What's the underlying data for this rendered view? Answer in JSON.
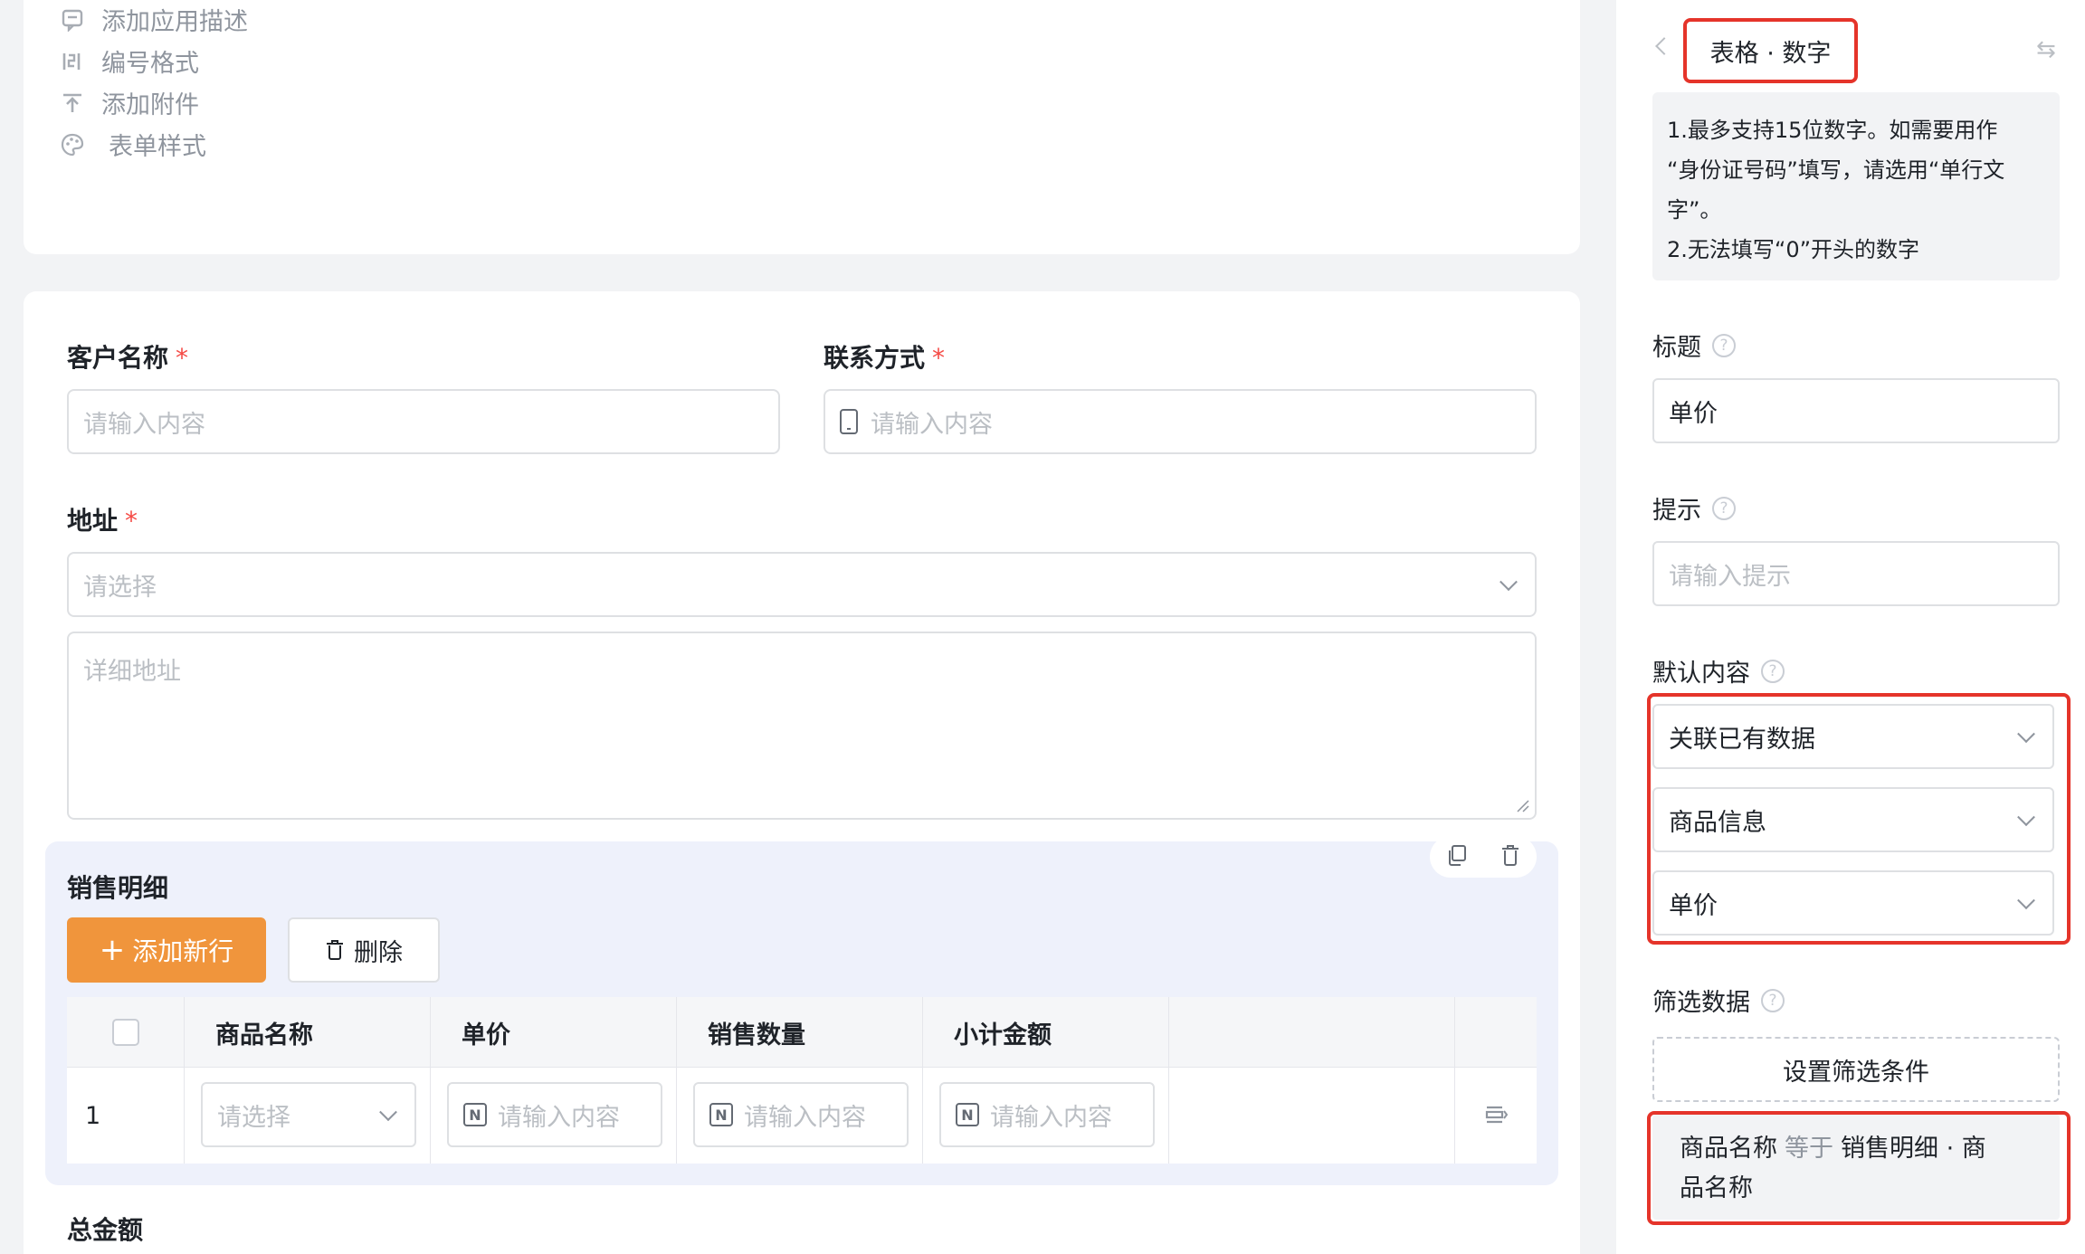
{
  "top_menu": {
    "items": [
      {
        "label": "添加应用描述",
        "icon": "comment-icon"
      },
      {
        "label": "编号格式",
        "icon": "number-format-icon"
      },
      {
        "label": "添加附件",
        "icon": "upload-icon"
      },
      {
        "label": "表单样式",
        "icon": "palette-icon"
      }
    ]
  },
  "form": {
    "customer": {
      "label": "客户名称",
      "required": "*",
      "placeholder": "请输入内容"
    },
    "contact": {
      "label": "联系方式",
      "required": "*",
      "placeholder": "请输入内容"
    },
    "address": {
      "label": "地址",
      "required": "*",
      "select_placeholder": "请选择",
      "detail_placeholder": "详细地址"
    },
    "sales_detail": {
      "title": "销售明细",
      "add_button": "添加新行",
      "delete_button": "删除",
      "columns": [
        "商品名称",
        "单价",
        "销售数量",
        "小计金额"
      ],
      "row": {
        "index": "1",
        "product_placeholder": "请选择",
        "price_placeholder": "请输入内容",
        "qty_placeholder": "请输入内容",
        "subtotal_placeholder": "请输入内容"
      }
    },
    "total_label": "总金额"
  },
  "panel": {
    "field_type": "表格 · 数字",
    "tip_lines": [
      "1.最多支持15位数字。如需要用作",
      "“身份证号码”填写，请选用“单行文",
      "字”。",
      "2.无法填写“0”开头的数字"
    ],
    "title_label": "标题",
    "title_value": "单价",
    "hint_label": "提示",
    "hint_placeholder": "请输入提示",
    "default_label": "默认内容",
    "default_mode": "关联已有数据",
    "default_source": "商品信息",
    "default_field": "单价",
    "filter_label": "筛选数据",
    "filter_button": "设置筛选条件",
    "condition": {
      "field": "商品名称",
      "operator": "等于",
      "value_line1": "销售明细 · 商",
      "value_line2": "品名称"
    }
  },
  "colors": {
    "accent": "#f0953c",
    "highlight": "#e5342a",
    "required": "#f54a45"
  }
}
